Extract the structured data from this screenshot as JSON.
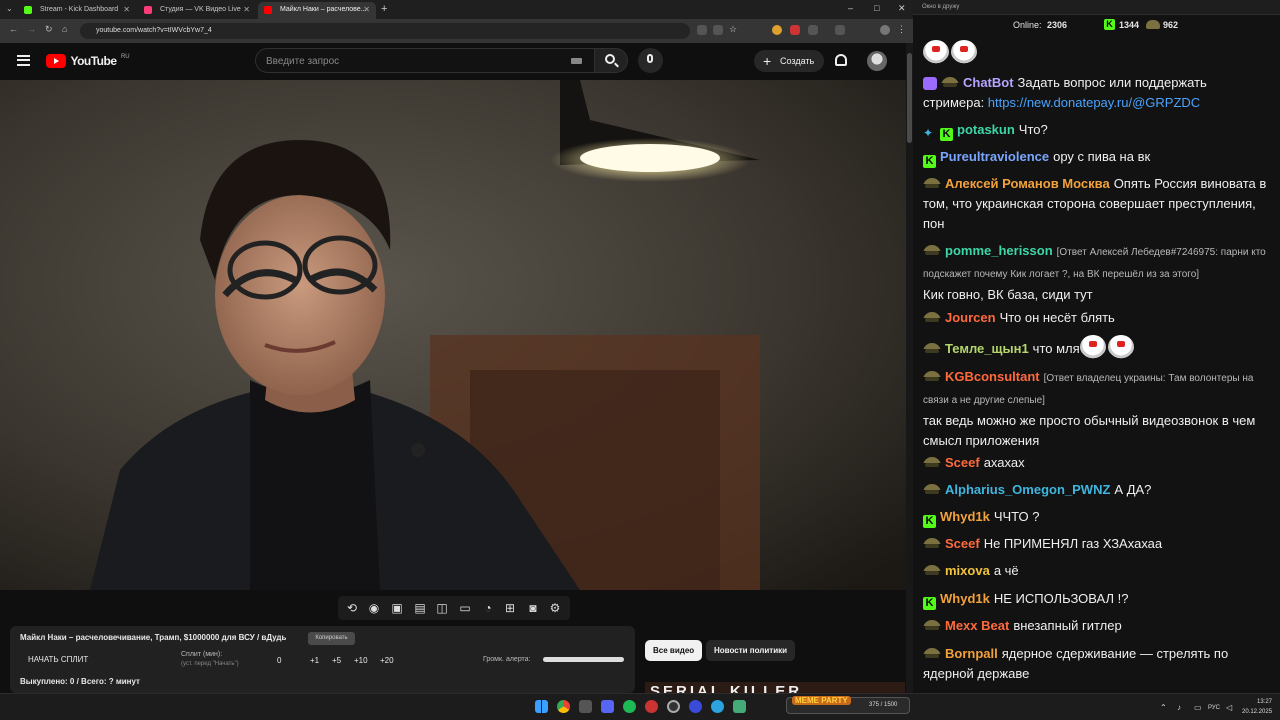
{
  "browser": {
    "tabs": [
      {
        "label": "Stream - Kick Dashboard",
        "color": "#53fc18"
      },
      {
        "label": "Студия — VK Видео Live",
        "color": "#ff3c78"
      },
      {
        "label": "Майкл Наки – расчелове...",
        "color": "#ff0000"
      }
    ],
    "url": "youtube.com/watch?v=tIWVcbYw7_4",
    "window_controls": {
      "minimize": "–",
      "maximize": "□",
      "close": "✕"
    }
  },
  "youtube": {
    "logo_text": "YouTube",
    "region": "RU",
    "search_placeholder": "Введите запрос",
    "create_label": "Создать"
  },
  "video": {
    "description": "Мужчина в очках и чёрной водолазке на фоне лампы"
  },
  "panel": {
    "title": "Майкл Наки – расчеловечивание, Трамп, $1000000 для ВСУ / вДудь",
    "copy_label": "Копировать",
    "start_split": "НАЧАТЬ СПЛИТ",
    "split_label": "Сплит (мин):",
    "split_hint": "(уст. перед \"Начать\")",
    "split_value": "0",
    "increments": [
      "+1",
      "+5",
      "+10",
      "+20"
    ],
    "alert_volume_label": "Громк. алерта:",
    "alert_volume": 1.0,
    "bought": "Выкуплено: 0 / Всего: ? минут"
  },
  "chips": [
    "Все видео",
    "Новости политики"
  ],
  "thumbnail_text": "SERIAL KILLER",
  "widget": {
    "title": "MEME PARTY",
    "progress_text": "375 / 1500"
  },
  "chat": {
    "window_title": "Окно в дружу",
    "online_label": "Online:",
    "online_value": "2306",
    "kick_count": "1344",
    "other_count": "962",
    "messages": [
      {
        "user": "ChatBot",
        "color": "#b7a4ff",
        "text": "Задать вопрос или поддержать стримера: ",
        "link": "https://new.donatepay.ru/@GRPZDC"
      },
      {
        "user": "potaskun",
        "color": "#3ed6a6",
        "text": "Что?"
      },
      {
        "user": "Pureultraviolence",
        "color": "#7aa6ff",
        "text": "ору с пива на вк"
      },
      {
        "user": "Алексей Романов Москва",
        "color": "#f2a23c",
        "text": "Опять Россия виновата в том, что украинская сторона совершает преступления, пон"
      },
      {
        "user": "pomme_herisson",
        "color": "#3ed6a6",
        "reply": "[Ответ Алексей Лебедев#7246975: парни кто подскажет почему Кик логает ?, на ВК перешёл из за этого]",
        "text": "Кик говно, ВК база, сиди тут"
      },
      {
        "user": "Jourcen",
        "color": "#ff6a3d",
        "text": "Что он несёт блять"
      },
      {
        "user": "Темле_щын1",
        "color": "#b5d66b",
        "text": "что мля"
      },
      {
        "user": "KGBconsultant",
        "color": "#ff6a3d",
        "reply": "[Ответ владелец украины: Там волонтеры на связи а не другие слепые]",
        "text": "так ведь можно же просто обычный видеозвонок в чем смысл приложения"
      },
      {
        "user": "Sceef",
        "color": "#ff6a3d",
        "text": "ахахах"
      },
      {
        "user": "Alpharius_Omegon_PWNZ",
        "color": "#3fb6e0",
        "text": "А ДА?"
      },
      {
        "user": "Whyd1k",
        "color": "#f2a23c",
        "text": "ЧЧТО ?"
      },
      {
        "user": "Sceef",
        "color": "#ff6a3d",
        "text": "Не ПРИМЕНЯЛ газ ХЗАхахаа"
      },
      {
        "user": "mixova",
        "color": "#f2c33c",
        "text": "а чё"
      },
      {
        "user": "Whyd1k",
        "color": "#f2a23c",
        "text": "НЕ ИСПОЛЬЗОВАЛ !?"
      },
      {
        "user": "Mexx Beat",
        "color": "#ff6a3d",
        "text": "внезапный гитлер"
      },
      {
        "user": "Bornpall",
        "color": "#f2a23c",
        "text": "ядерное сдерживание — стрелять по ядерной державе"
      }
    ]
  },
  "taskbar": {
    "lang": "РУС",
    "time": "13:27",
    "date": "20.12.2025"
  }
}
